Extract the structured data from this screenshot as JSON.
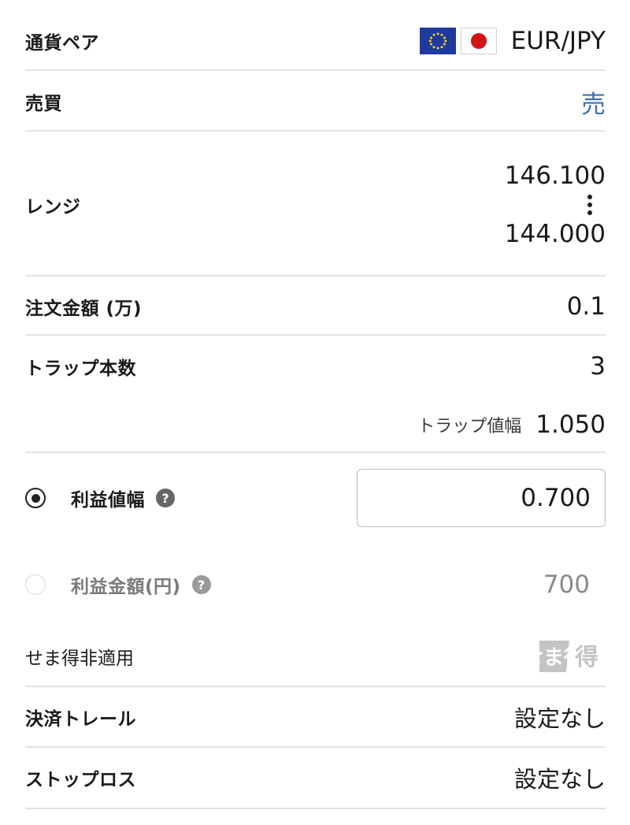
{
  "currency_pair": {
    "label": "通貨ペア",
    "value": "EUR/JPY",
    "flag_left_icon": "eu-flag-icon",
    "flag_right_icon": "japan-flag-icon"
  },
  "side": {
    "label": "売買",
    "value": "売",
    "color": "#3d6fb0"
  },
  "range": {
    "label": "レンジ",
    "upper": "146.100",
    "lower": "144.000",
    "separator_icon": "vertical-ellipsis-icon"
  },
  "order_amount": {
    "label": "注文金額 (万)",
    "value": "0.1"
  },
  "trap_count": {
    "label": "トラップ本数",
    "value": "3"
  },
  "trap_width": {
    "label": "トラップ値幅",
    "value": "1.050"
  },
  "profit_width": {
    "label": "利益値幅",
    "value": "0.700",
    "selected": true,
    "help_icon": "question-circle-icon"
  },
  "profit_amount": {
    "label": "利益金額(円)",
    "value": "700",
    "selected": false,
    "help_icon": "question-circle-icon"
  },
  "semadoku": {
    "label": "せま得非適用",
    "badge_text": "せま得",
    "badge_icon": "semadoku-badge-icon"
  },
  "trail_settlement": {
    "label": "決済トレール",
    "value": "設定なし"
  },
  "stop_loss": {
    "label": "ストップロス",
    "value": "設定なし"
  }
}
